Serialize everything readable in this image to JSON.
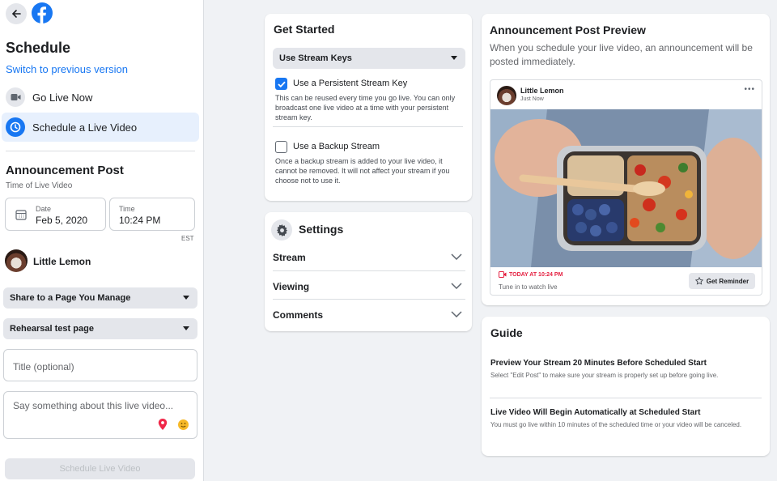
{
  "left_panel": {
    "title": "Schedule",
    "switch_link": "Switch to previous version",
    "options": [
      {
        "label": "Go Live Now",
        "icon": "video-camera-icon"
      },
      {
        "label": "Schedule a Live Video",
        "icon": "clock-icon"
      }
    ],
    "announcement": {
      "title": "Announcement Post",
      "time_label": "Time of Live Video",
      "date_label": "Date",
      "date_value": "Feb 5, 2020",
      "time_label_small": "Time",
      "time_value": "10:24 PM",
      "timezone": "EST"
    },
    "page_name": "Little Lemon",
    "share_select": "Share to a Page You Manage",
    "page_select": "Rehearsal test page",
    "title_placeholder": "Title (optional)",
    "description_placeholder": "Say something about this live video...",
    "schedule_button": "Schedule Live Video"
  },
  "get_started": {
    "title": "Get Started",
    "stream_keys_select": "Use Stream Keys",
    "persistent_key": {
      "label": "Use a Persistent Stream Key",
      "checked": true,
      "description": "This can be reused every time you go live. You can only broadcast one live video at a time with your persistent stream key."
    },
    "backup_stream": {
      "label": "Use a Backup Stream",
      "checked": false,
      "description": "Once a backup stream is added to your live video, it cannot be removed. It will not affect your stream if you choose not to use it."
    }
  },
  "settings": {
    "title": "Settings",
    "rows": [
      "Stream",
      "Viewing",
      "Comments"
    ]
  },
  "preview": {
    "title": "Announcement Post Preview",
    "description": "When you schedule your live video, an announcement will be posted immediately.",
    "post": {
      "author": "Little Lemon",
      "time": "Just Now",
      "more": "•••",
      "live_time": "TODAY AT 10:24 PM",
      "tune_in": "Tune in to watch live",
      "reminder_button": "Get Reminder"
    }
  },
  "guide": {
    "title": "Guide",
    "items": [
      {
        "title": "Preview Your Stream 20 Minutes Before Scheduled Start",
        "description": "Select \"Edit Post\" to make sure your stream is properly set up before going live."
      },
      {
        "title": "Live Video Will Begin Automatically at Scheduled Start",
        "description": "You must go live within 10 minutes of the scheduled time or your video will be canceled."
      }
    ]
  },
  "colors": {
    "accent": "#1877f2",
    "live_red": "#e41e3f",
    "background": "#f0f2f5"
  }
}
